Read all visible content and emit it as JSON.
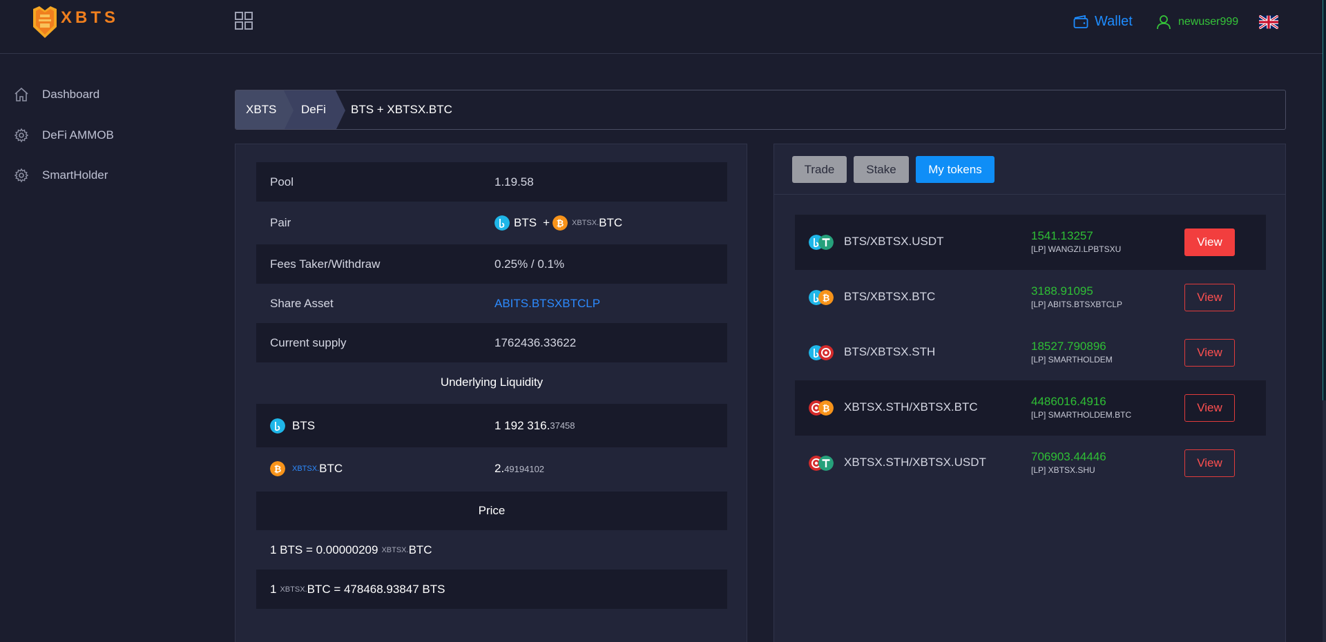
{
  "header": {
    "logo_text": "XBTS",
    "wallet_label": "Wallet",
    "username": "newuser999",
    "language": "uk-flag-icon"
  },
  "sidebar": {
    "items": [
      {
        "label": "Dashboard",
        "icon": "home-icon"
      },
      {
        "label": "DeFi AMMOB",
        "icon": "gear-icon"
      },
      {
        "label": "SmartHolder",
        "icon": "gear-icon"
      }
    ]
  },
  "breadcrumb": [
    "XBTS",
    "DeFi",
    "BTS + XBTSX.BTC"
  ],
  "pool_info": {
    "pool_label": "Pool",
    "pool_value": "1.19.58",
    "pair_label": "Pair",
    "pair_a": "BTS",
    "pair_plus": "+",
    "pair_b_prefix": "XBTSX.",
    "pair_b": "BTC",
    "fees_label": "Fees Taker/Withdraw",
    "fees_value": "0.25% / 0.1%",
    "share_label": "Share Asset",
    "share_value": "ABITS.BTSXBTCLP",
    "supply_label": "Current supply",
    "supply_value": "1762436.33622",
    "liquidity_header": "Underlying Liquidity",
    "liq_a_name": "BTS",
    "liq_a_int": "1 192 316.",
    "liq_a_dec": "37458",
    "liq_b_prefix": "XBTSX.",
    "liq_b_name": "BTC",
    "liq_b_int": "2.",
    "liq_b_dec": "49194102",
    "price_header": "Price",
    "price1_left": "1 BTS = 0.00000209",
    "price1_prefix": "XBTSX.",
    "price1_right": "BTC",
    "price2_one": "1",
    "price2_prefix": "XBTSX.",
    "price2_right": "BTC = 478468.93847 BTS"
  },
  "tabs": [
    "Trade",
    "Stake",
    "My tokens"
  ],
  "my_tokens": [
    {
      "pair": "BTS/XBTSX.USDT",
      "amount": "1541.13257",
      "lp": "[LP] WANGZI.LPBTSXU",
      "button": "View"
    },
    {
      "pair": "BTS/XBTSX.BTC",
      "amount": "3188.91095",
      "lp": "[LP] ABITS.BTSXBTCLP",
      "button": "View"
    },
    {
      "pair": "BTS/XBTSX.STH",
      "amount": "18527.790896",
      "lp": "[LP] SMARTHOLDEM",
      "button": "View"
    },
    {
      "pair": "XBTSX.STH/XBTSX.BTC",
      "amount": "4486016.4916",
      "lp": "[LP] SMARTHOLDEM.BTC",
      "button": "View"
    },
    {
      "pair": "XBTSX.STH/XBTSX.USDT",
      "amount": "706903.44446",
      "lp": "[LP] XBTSX.SHU",
      "button": "View"
    }
  ],
  "colors": {
    "bts": "#1fb6e8",
    "btc": "#f7931a",
    "usdt": "#26a17b",
    "sth": "#d42b2b",
    "accent": "#0f8ef7",
    "positive": "#2fbf35",
    "danger": "#f23e3e"
  }
}
